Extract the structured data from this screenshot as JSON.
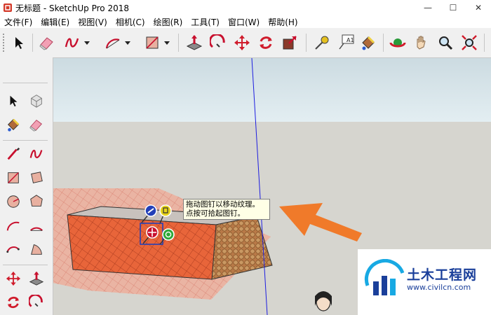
{
  "window": {
    "title": "无标题 - SketchUp Pro 2018",
    "minimize": "—",
    "maximize": "☐",
    "close": "✕"
  },
  "menu": [
    {
      "label": "文件(F)"
    },
    {
      "label": "编辑(E)"
    },
    {
      "label": "视图(V)"
    },
    {
      "label": "相机(C)"
    },
    {
      "label": "绘图(R)"
    },
    {
      "label": "工具(T)"
    },
    {
      "label": "窗口(W)"
    },
    {
      "label": "帮助(H)"
    }
  ],
  "toolbar": {
    "text_tool_glyph": "A1"
  },
  "tooltip": {
    "line1": "拖动图钉以移动纹理。",
    "line2": "点按可拾起图钉。"
  },
  "watermark": {
    "brand": "土木工程网",
    "url": "www.civilcn.com"
  },
  "colors": {
    "selection_face": "#e8653a",
    "texture_pin_blue": "#2340b8",
    "arrow": "#f07a2a",
    "axis_blue": "#1d1de0"
  }
}
